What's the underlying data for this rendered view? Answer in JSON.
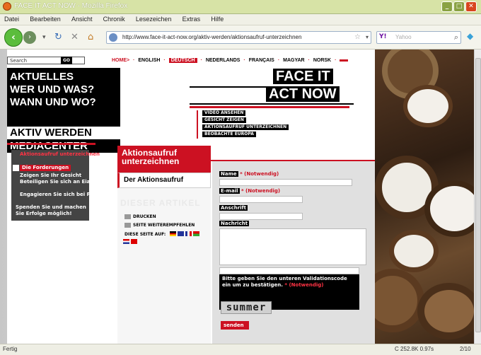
{
  "window": {
    "title": "FACE IT ACT NOW - Mozilla Firefox",
    "min": "_",
    "max": "□",
    "close": "✕"
  },
  "menu": [
    "Datei",
    "Bearbeiten",
    "Ansicht",
    "Chronik",
    "Lesezeichen",
    "Extras",
    "Hilfe"
  ],
  "nav": {
    "url": "http://www.face-it-act-now.org/aktiv-werden/aktionsaufruf-unterzeichnen",
    "search_engine": "Y!",
    "search_placeholder": "Yahoo"
  },
  "site": {
    "search_label": "Search",
    "go_label": "GO",
    "languages": {
      "home": "HOME>",
      "items": [
        "ENGLISH",
        "DEUTSCH",
        "NEDERLANDS",
        "FRANÇAIS",
        "MAGYAR",
        "NORSK"
      ]
    },
    "main_nav": [
      "AKTUELLES",
      "WER UND WAS?",
      "WANN UND WO?",
      "AKTIV WERDEN",
      "MEDIACENTER"
    ],
    "logo_line1": "FACE IT",
    "logo_line2": "ACT NOW",
    "small_links": [
      "VIDEO ANSEHEN",
      "GESICHT ZEIGEN",
      "AKTIONSAUFRUF UNTERZEICHNEN",
      "BEOBACHTE EUROPA"
    ],
    "subnav": {
      "heading": "Aktionsaufruf unterzeichnen",
      "items": [
        "Die Forderungen",
        "Zeigen Sie Ihr Gesicht",
        "Beteiligen Sie sich an Eiaktionen",
        "Engagieren Sie sich bei FIAN",
        "Spenden Sie und machen Sie Erfolge möglich!"
      ]
    },
    "page_title": "Aktionsaufruf unterzeichnen",
    "aktion_link": "Der Aktionsaufruf",
    "dieser_artikel": "DIESER ARTIKEL",
    "tools": {
      "print": "DRUCKEN",
      "recommend": "SEITE WEITEREMPFEHLEN",
      "on": "DIESE SEITE AUF:"
    },
    "form": {
      "name_label": "Name",
      "email_label": "E-mail",
      "address_label": "Anschrift",
      "message_label": "Nachricht",
      "required": "* (Notwendig)",
      "captcha_hint": "Bitte geben Sie den unteren Validationscode ein um zu bestätigen.",
      "captcha_code": "summer",
      "submit": "senden"
    }
  },
  "status": {
    "text": "Fertig",
    "info": "C 252.8K 0.97s",
    "pages": "2/10"
  },
  "colors": {
    "accent": "#cc1122",
    "chrome": "#d7e3a6"
  }
}
